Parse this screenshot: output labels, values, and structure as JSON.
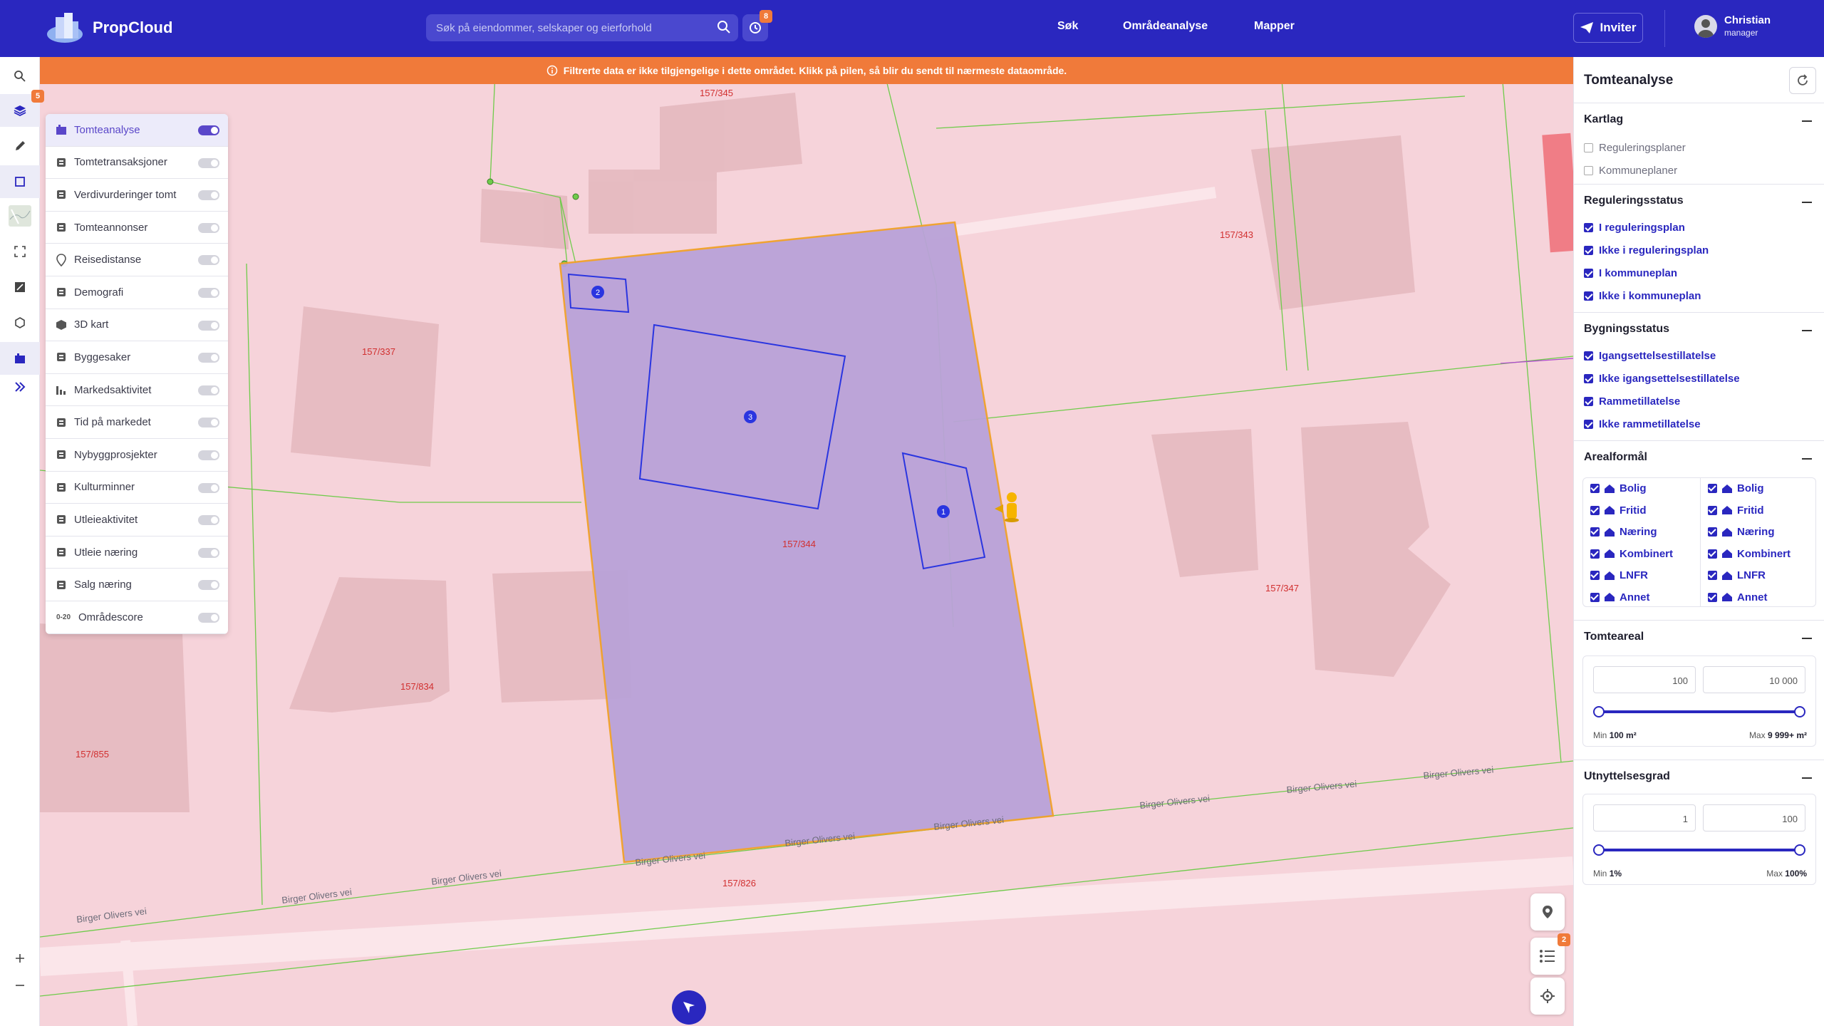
{
  "app": {
    "name": "PropCloud"
  },
  "search": {
    "placeholder": "Søk på eiendommer, selskaper og eierforhold"
  },
  "history": {
    "badge": "8"
  },
  "nav": {
    "sok": "Søk",
    "omradeanalyse": "Områdeanalyse",
    "mapper": "Mapper"
  },
  "invite": {
    "label": "Inviter"
  },
  "user": {
    "name": "Christian",
    "role": "manager"
  },
  "lefttool": {
    "layers_badge": "5"
  },
  "banner": {
    "text": "Filtrerte data er ikke tilgjengelige i dette området. Klikk på pilen, så blir du sendt til nærmeste dataområde."
  },
  "layers": [
    {
      "label": "Tomteanalyse",
      "on": true,
      "icon": "plot-analysis-icon"
    },
    {
      "label": "Tomtetransaksjoner",
      "on": false,
      "icon": "transactions-icon"
    },
    {
      "label": "Verdivurderinger tomt",
      "on": false,
      "icon": "valuation-icon"
    },
    {
      "label": "Tomteannonser",
      "on": false,
      "icon": "listings-icon"
    },
    {
      "label": "Reisedistanse",
      "on": false,
      "icon": "location-pin-icon"
    },
    {
      "label": "Demografi",
      "on": false,
      "icon": "demography-icon"
    },
    {
      "label": "3D kart",
      "on": false,
      "icon": "cube-icon"
    },
    {
      "label": "Byggesaker",
      "on": false,
      "icon": "building-cases-icon"
    },
    {
      "label": "Markedsaktivitet",
      "on": false,
      "icon": "bar-chart-icon"
    },
    {
      "label": "Tid på markedet",
      "on": false,
      "icon": "time-on-market-icon"
    },
    {
      "label": "Nybyggprosjekter",
      "on": false,
      "icon": "new-building-icon"
    },
    {
      "label": "Kulturminner",
      "on": false,
      "icon": "heritage-icon"
    },
    {
      "label": "Utleieaktivitet",
      "on": false,
      "icon": "rental-icon"
    },
    {
      "label": "Utleie næring",
      "on": false,
      "icon": "commercial-rental-icon"
    },
    {
      "label": "Salg næring",
      "on": false,
      "icon": "commercial-sale-icon"
    },
    {
      "label": "Områdescore",
      "on": false,
      "icon": "area-score-icon",
      "prefix": "0-20"
    }
  ],
  "map": {
    "parcels": [
      "157/345",
      "157/343",
      "157/337",
      "157/344",
      "157/347",
      "157/834",
      "157/855",
      "157/826"
    ],
    "road": "Birger Olivers vei",
    "buildings": [
      "1",
      "2",
      "3"
    ]
  },
  "controls": {
    "list_badge": "2"
  },
  "rpanel": {
    "title": "Tomteanalyse",
    "kartlag": {
      "title": "Kartlag",
      "items": [
        "Reguleringsplaner",
        "Kommuneplaner"
      ]
    },
    "regstatus": {
      "title": "Reguleringsstatus",
      "items": [
        "I reguleringsplan",
        "Ikke i reguleringsplan",
        "I kommuneplan",
        "Ikke i kommuneplan"
      ]
    },
    "bygg": {
      "title": "Bygningsstatus",
      "items": [
        "Igangsettelsestillatelse",
        "Ikke igangsettelsestillatelse",
        "Rammetillatelse",
        "Ikke rammetillatelse"
      ]
    },
    "areal": {
      "title": "Arealformål",
      "items": [
        "Bolig",
        "Fritid",
        "Næring",
        "Kombinert",
        "LNFR",
        "Annet"
      ]
    },
    "tomteareal": {
      "title": "Tomteareal",
      "min_val": "100",
      "max_val": "10 000",
      "min_lbl": "Min",
      "min_txt": "100 m²",
      "max_lbl": "Max",
      "max_txt": "9 999+ m²"
    },
    "utnytt": {
      "title": "Utnyttelsesgrad",
      "min_val": "1",
      "max_val": "100",
      "min_lbl": "Min",
      "min_txt": "1%",
      "max_lbl": "Max",
      "max_txt": "100%"
    }
  }
}
